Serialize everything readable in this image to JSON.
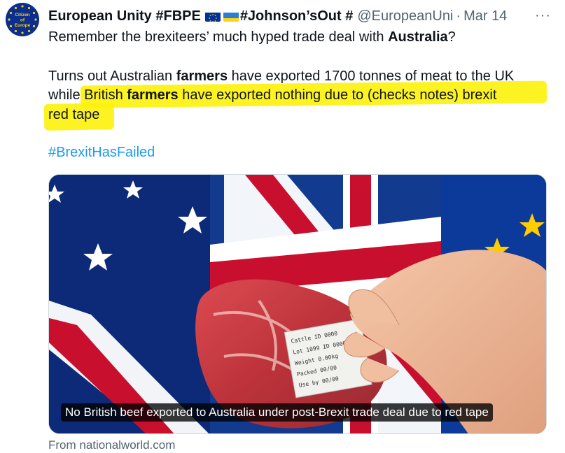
{
  "author": {
    "avatar_text": [
      "Citizen",
      "of",
      "Europe"
    ],
    "name": "European Unity #FBPE",
    "name_suffix": "#Johnson’sOut #",
    "handle": "@EuropeanUni",
    "separator": "·",
    "date": "Mar 14",
    "more_icon": "more-dots-icon",
    "more_label": "···"
  },
  "tweet": {
    "line1_pre": "Remember the brexiteers’ much hyped trade deal with ",
    "line1_bold": "Australia",
    "line1_post": "?",
    "line2_pre": "Turns out Australian ",
    "line2_bold": "farmers",
    "line2_post": " have exported 1700 tonnes of meat to the UK",
    "line3_pre": "while British ",
    "line3_bold": "farmers",
    "line3_post": " have exported nothing due to (checks notes) brexit",
    "line4": "red tape",
    "hashtag": "#BrexitHasFailed",
    "highlight_color": "#fdf20a",
    "hashtag_color": "#1d9bf0"
  },
  "media": {
    "caption": "No British beef exported to Australia under post-Brexit trade deal due to red tape",
    "label_lines": [
      "Cattle ID 0000",
      "Lot 1099 ID 0000",
      "Weight 0.00kg",
      "Packed 00/00",
      "Use by 00/00"
    ]
  },
  "link": {
    "source": "From nationalworld.com"
  }
}
